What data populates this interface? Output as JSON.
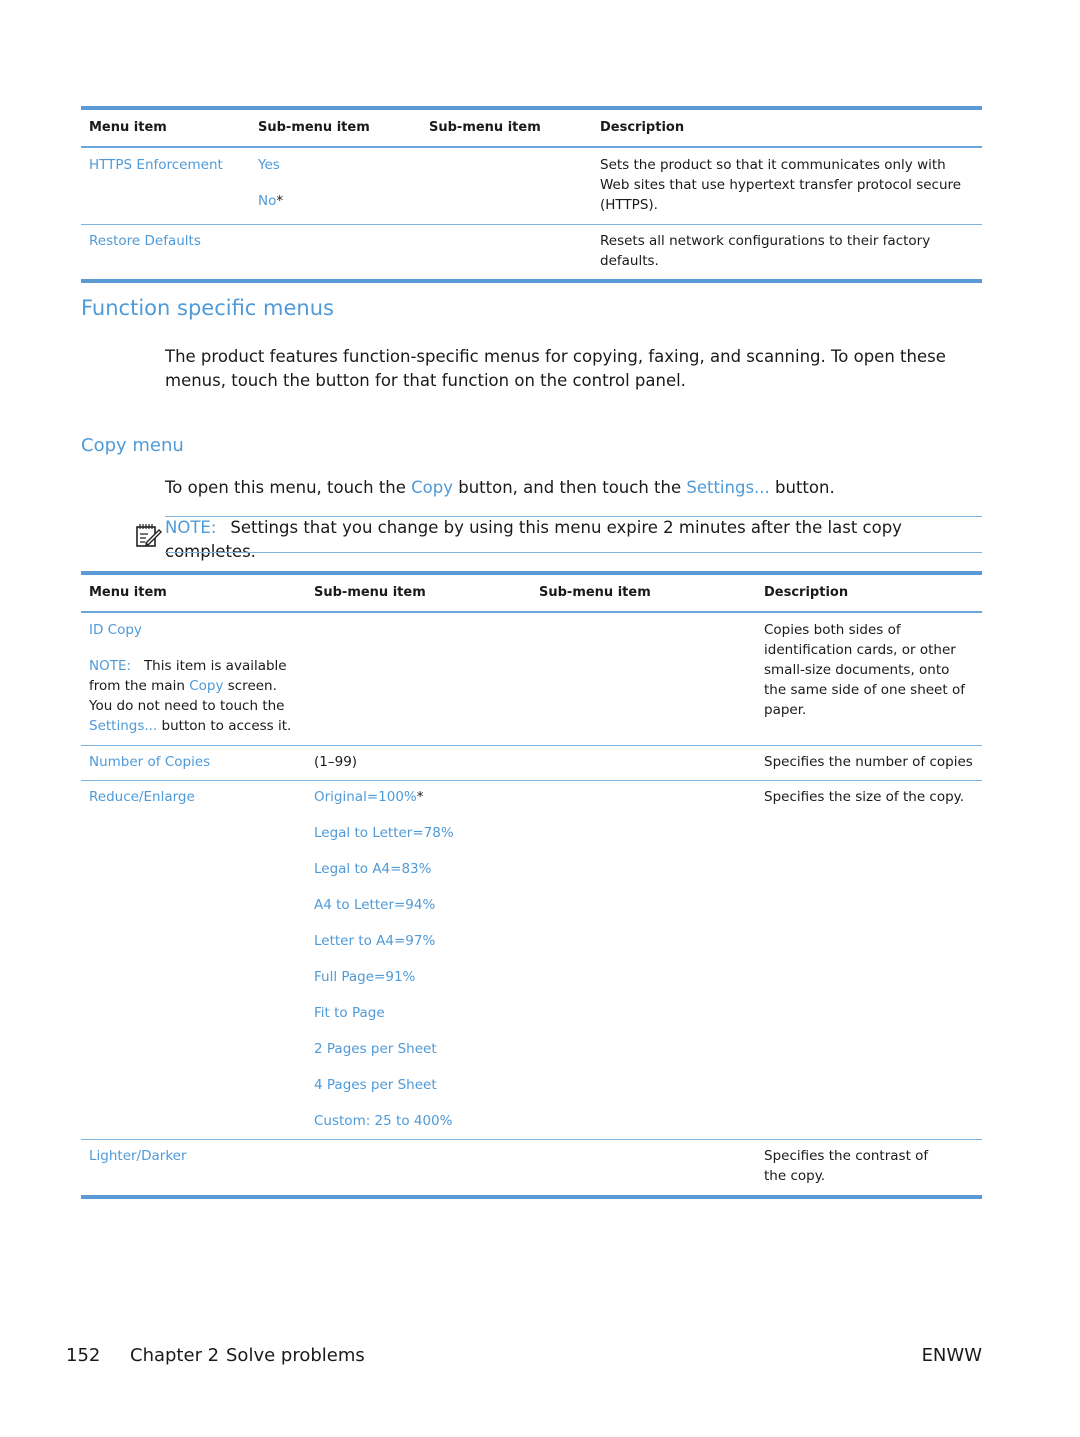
{
  "table1": {
    "headers": [
      "Menu item",
      "Sub-menu item",
      "Sub-menu item",
      "Description"
    ],
    "rows": [
      {
        "menu_item": "HTTPS Enforcement",
        "sub_items": [
          {
            "label": "Yes",
            "suffix": ""
          },
          {
            "label": "No",
            "suffix": "*"
          }
        ],
        "description": "Sets the product so that it communicates only with Web sites that use hypertext transfer protocol secure (HTTPS)."
      },
      {
        "menu_item": "Restore Defaults",
        "description": "Resets all network configurations to their factory defaults."
      }
    ]
  },
  "section": {
    "title": "Function specific menus",
    "intro": "The product features function-specific menus for copying, faxing, and scanning. To open these menus, touch the button for that function on the control panel."
  },
  "copy_menu": {
    "title": "Copy menu",
    "instruction": {
      "part1": "To open this menu, touch the ",
      "link1": "Copy",
      "part2": " button, and then touch the ",
      "link2": "Settings...",
      "part3": " button."
    },
    "note": {
      "icon": "note-pencil-icon",
      "label": "NOTE:",
      "text": "Settings that you change by using this menu expire 2 minutes after the last copy completes."
    }
  },
  "table2": {
    "headers": [
      "Menu item",
      "Sub-menu item",
      "Sub-menu item",
      "Description"
    ],
    "rows": [
      {
        "menu_item": "ID Copy",
        "note": {
          "label": "NOTE:",
          "t1": "This item is available from the main ",
          "link1": "Copy",
          "t2": " screen. You do not need to touch the ",
          "link2": "Settings...",
          "t3": " button to access it."
        },
        "description": "Copies both sides of identification cards, or other small-size documents, onto the same side of one sheet of paper."
      },
      {
        "menu_item": "Number of Copies",
        "sub_item": "(1–99)",
        "description": "Specifies the number of copies"
      },
      {
        "menu_item": "Reduce/Enlarge",
        "sub_items": [
          {
            "label": "Original=100%",
            "suffix": "*"
          },
          {
            "label": "Legal to Letter=78%",
            "suffix": ""
          },
          {
            "label": "Legal to A4=83%",
            "suffix": ""
          },
          {
            "label": "A4 to Letter=94%",
            "suffix": ""
          },
          {
            "label": "Letter to A4=97%",
            "suffix": ""
          },
          {
            "label": "Full Page=91%",
            "suffix": ""
          },
          {
            "label": "Fit to Page",
            "suffix": ""
          },
          {
            "label": "2 Pages per Sheet",
            "suffix": ""
          },
          {
            "label": "4 Pages per Sheet",
            "suffix": ""
          },
          {
            "label": "Custom: 25 to 400%",
            "suffix": ""
          }
        ],
        "description": "Specifies the size of the copy."
      },
      {
        "menu_item": "Lighter/Darker",
        "description": "Specifies the contrast of the copy."
      }
    ]
  },
  "footer": {
    "page_number": "152",
    "chapter": "Chapter 2",
    "chapter_title": "Solve problems",
    "right_label": "ENWW"
  },
  "colors": {
    "accent_blue": "#4f9ad8",
    "rule_blue": "#5b9bd5",
    "text": "#1a1a1a"
  }
}
